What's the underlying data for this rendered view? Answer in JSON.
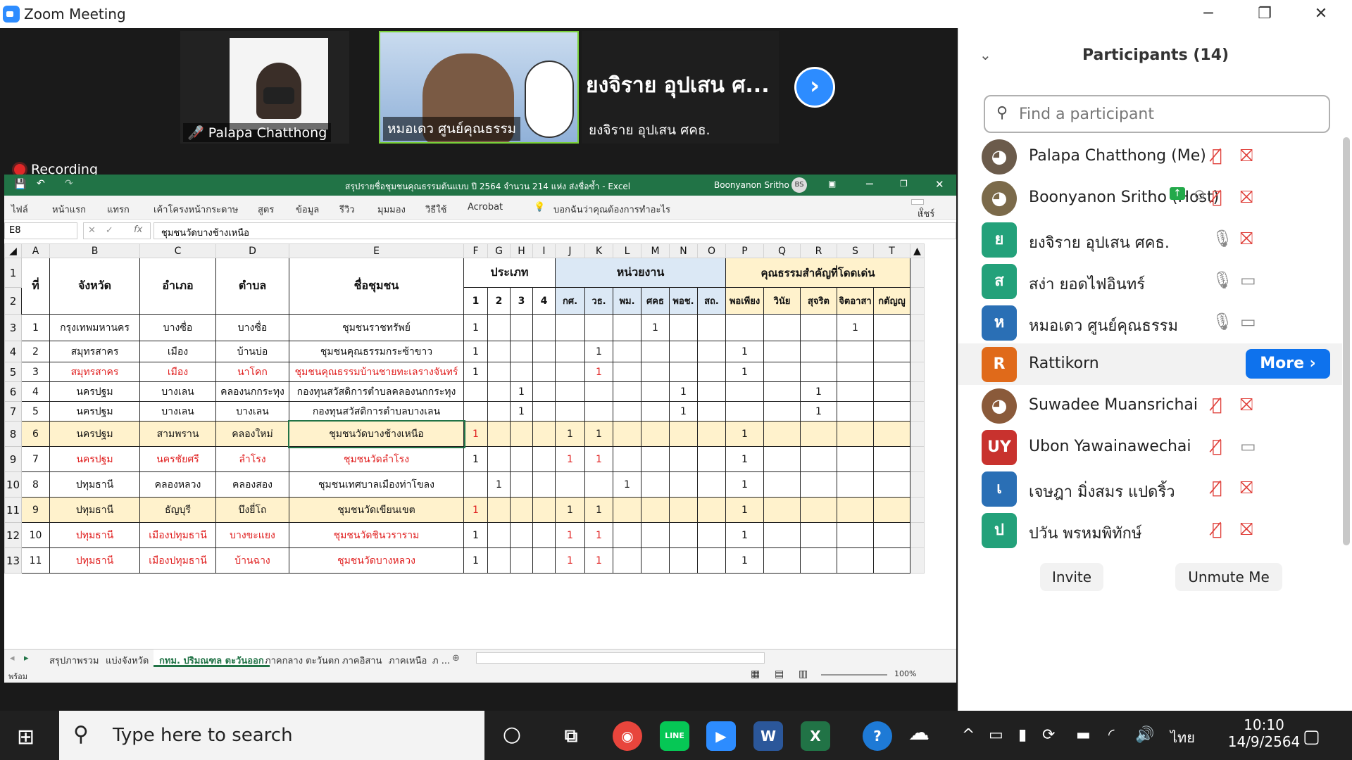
{
  "window": {
    "title": "Zoom Meeting"
  },
  "videos": [
    {
      "name": "Palapa Chatthong"
    },
    {
      "name": "หมอเดว ศูนย์คุณธรรม"
    },
    {
      "name": "ยงจิราย อุปเสน ศคธ.",
      "big": "ยงจิราย อุปเสน ศ..."
    }
  ],
  "recording": "Recording",
  "excel": {
    "title": "สรุปรายชื่อชุมชนคุณธรรมต้นแบบ ปี 2564 จำนวน 214 แห่ง ส่งชื่อซ้ำ - Excel",
    "user": "Boonyanon Sritho",
    "user_initials": "BS",
    "ribbon": [
      "ไฟล์",
      "หน้าแรก",
      "แทรก",
      "เค้าโครงหน้ากระดาษ",
      "สูตร",
      "ข้อมูล",
      "รีวิว",
      "มุมมอง",
      "วิธีใช้",
      "Acrobat",
      "บอกฉันว่าคุณต้องการทำอะไร"
    ],
    "share": "แชร์",
    "namebox": "E8",
    "formula": "ชุมชนวัดบางช้างเหนือ",
    "columns": [
      "A",
      "B",
      "C",
      "D",
      "E",
      "F",
      "G",
      "H",
      "I",
      "J",
      "K",
      "L",
      "M",
      "N",
      "O",
      "P",
      "Q",
      "R",
      "S",
      "T"
    ],
    "header1": {
      "num": "ที่",
      "province": "จังหวัด",
      "district": "อำเภอ",
      "subdistrict": "ตำบล",
      "community": "ชื่อชุมชน",
      "type": "ประเภท",
      "agency": "หน่วยงาน",
      "virtue": "คุณธรรมสำคัญที่โดดเด่น"
    },
    "header2": [
      "1",
      "2",
      "3",
      "4",
      "กศ.",
      "วธ.",
      "พม.",
      "ศคธ",
      "พอช.",
      "สถ.",
      "พอเพียง",
      "วินัย",
      "สุจริต",
      "จิตอาสา",
      "กตัญญู"
    ],
    "rows": [
      {
        "r": "3",
        "n": "1",
        "b": "กรุงเทพมหานคร",
        "c": "บางซื่อ",
        "d": "บางซื่อ",
        "e": "ชุมชนราชทรัพย์",
        "f": "1",
        "g": "",
        "h": "",
        "i": "",
        "j": "",
        "k": "",
        "l": "",
        "m": "1",
        "nn": "",
        "o": "",
        "p": "",
        "q": "",
        "rr": "",
        "s": "1",
        "t": "",
        "style": ""
      },
      {
        "r": "4",
        "n": "2",
        "b": "สมุทรสาคร",
        "c": "เมือง",
        "d": "บ้านบ่อ",
        "e": "ชุมชนคุณธรรมกระซ้าขาว",
        "f": "1",
        "g": "",
        "h": "",
        "i": "",
        "j": "",
        "k": "1",
        "l": "",
        "m": "",
        "nn": "",
        "o": "",
        "p": "1",
        "q": "",
        "rr": "",
        "s": "",
        "t": "",
        "style": ""
      },
      {
        "r": "5",
        "n": "3",
        "b": "สมุทรสาคร",
        "c": "เมือง",
        "d": "นาโคก",
        "e": "ชุมชนคุณธรรมบ้านชายทะเลรางจันทร์",
        "f": "1",
        "g": "",
        "h": "",
        "i": "",
        "j": "",
        "k": "1",
        "l": "",
        "m": "",
        "nn": "",
        "o": "",
        "p": "1",
        "q": "",
        "rr": "",
        "s": "",
        "t": "",
        "style": "red"
      },
      {
        "r": "6",
        "n": "4",
        "b": "นครปฐม",
        "c": "บางเลน",
        "d": "คลองนกกระทุง",
        "e": "กองทุนสวัสดิการตำบลคลองนกกระทุง",
        "f": "",
        "g": "",
        "h": "1",
        "i": "",
        "j": "",
        "k": "",
        "l": "",
        "m": "",
        "nn": "1",
        "o": "",
        "p": "",
        "q": "",
        "rr": "1",
        "s": "",
        "t": "",
        "style": ""
      },
      {
        "r": "7",
        "n": "5",
        "b": "นครปฐม",
        "c": "บางเลน",
        "d": "บางเลน",
        "e": "กองทุนสวัสดิการตำบลบางเลน",
        "f": "",
        "g": "",
        "h": "1",
        "i": "",
        "j": "",
        "k": "",
        "l": "",
        "m": "",
        "nn": "1",
        "o": "",
        "p": "",
        "q": "",
        "rr": "1",
        "s": "",
        "t": "",
        "style": ""
      },
      {
        "r": "8",
        "n": "6",
        "b": "นครปฐม",
        "c": "สามพราน",
        "d": "คลองใหม่",
        "e": "ชุมชนวัดบางช้างเหนือ",
        "f": "1",
        "g": "",
        "h": "",
        "i": "",
        "j": "1",
        "k": "1",
        "l": "",
        "m": "",
        "nn": "",
        "o": "",
        "p": "1",
        "q": "",
        "rr": "",
        "s": "",
        "t": "",
        "style": "hl"
      },
      {
        "r": "9",
        "n": "7",
        "b": "นครปฐม",
        "c": "นครชัยศรี",
        "d": "ลำโรง",
        "e": "ชุมชนวัดลำโรง",
        "f": "1",
        "g": "",
        "h": "",
        "i": "",
        "j": "1",
        "k": "1",
        "l": "",
        "m": "",
        "nn": "",
        "o": "",
        "p": "1",
        "q": "",
        "rr": "",
        "s": "",
        "t": "",
        "style": "red"
      },
      {
        "r": "10",
        "n": "8",
        "b": "ปทุมธานี",
        "c": "คลองหลวง",
        "d": "คลองสอง",
        "e": "ชุมชนเทศบาลเมืองท่าโขลง",
        "f": "",
        "g": "1",
        "h": "",
        "i": "",
        "j": "",
        "k": "",
        "l": "1",
        "m": "",
        "nn": "",
        "o": "",
        "p": "1",
        "q": "",
        "rr": "",
        "s": "",
        "t": "",
        "style": ""
      },
      {
        "r": "11",
        "n": "9",
        "b": "ปทุมธานี",
        "c": "ธัญบุรี",
        "d": "บึงยี่โถ",
        "e": "ชุมชนวัดเขียนเขต",
        "f": "1",
        "g": "",
        "h": "",
        "i": "",
        "j": "1",
        "k": "1",
        "l": "",
        "m": "",
        "nn": "",
        "o": "",
        "p": "1",
        "q": "",
        "rr": "",
        "s": "",
        "t": "",
        "style": "hl"
      },
      {
        "r": "12",
        "n": "10",
        "b": "ปทุมธานี",
        "c": "เมืองปทุมธานี",
        "d": "บางขะแยง",
        "e": "ชุมชนวัดชินวราราม",
        "f": "1",
        "g": "",
        "h": "",
        "i": "",
        "j": "1",
        "k": "1",
        "l": "",
        "m": "",
        "nn": "",
        "o": "",
        "p": "1",
        "q": "",
        "rr": "",
        "s": "",
        "t": "",
        "style": "red"
      },
      {
        "r": "13",
        "n": "11",
        "b": "ปทุมธานี",
        "c": "เมืองปทุมธานี",
        "d": "บ้านฉาง",
        "e": "ชุมชนวัดบางหลวง",
        "f": "1",
        "g": "",
        "h": "",
        "i": "",
        "j": "1",
        "k": "1",
        "l": "",
        "m": "",
        "nn": "",
        "o": "",
        "p": "1",
        "q": "",
        "rr": "",
        "s": "",
        "t": "",
        "style": "red"
      }
    ],
    "sheets": [
      "สรุปภาพรวม",
      "แบ่งจังหวัด",
      "กทม. ปริมณฑล ตะวันออก",
      "ภาคกลาง ตะวันตก",
      "ภาคอิสาน",
      "ภาคเหนือ",
      "ภ ..."
    ],
    "status": "พร้อม",
    "zoom": "100%"
  },
  "participants": {
    "title": "Participants (14)",
    "search_placeholder": "Find a participant",
    "list": [
      {
        "name": "Palapa Chatthong (Me)",
        "initials": "",
        "color": "#6b5b4b",
        "mic": "off",
        "cam": "off"
      },
      {
        "name": "Boonyanon Sritho (Host)",
        "initials": "",
        "color": "#7b6a4a",
        "mic": "off",
        "cam": "off"
      },
      {
        "name": "ยงจิราย อุปเสน ศคธ.",
        "initials": "ย",
        "color": "#23a17a",
        "mic": "on",
        "cam": "off"
      },
      {
        "name": "สง่า ยอดไฟอินทร์",
        "initials": "ส",
        "color": "#23a17a",
        "mic": "on",
        "cam": "on"
      },
      {
        "name": "หมอเดว ศูนย์คุณธรรม",
        "initials": "ห",
        "color": "#2a6fb5",
        "mic": "on",
        "cam": "on"
      },
      {
        "name": "Rattikorn",
        "initials": "R",
        "color": "#e06a1a",
        "mic": "",
        "cam": ""
      },
      {
        "name": "Suwadee Muansrichai",
        "initials": "",
        "color": "#8a5a3a",
        "mic": "off",
        "cam": "off"
      },
      {
        "name": "Ubon Yawainawechai",
        "initials": "UY",
        "color": "#c8322e",
        "mic": "off",
        "cam": "on"
      },
      {
        "name": "เจษฎา มิ่งสมร แปดริ้ว",
        "initials": "เ",
        "color": "#2a6fb5",
        "mic": "off",
        "cam": "off"
      },
      {
        "name": "ปวัน พรหมพิทักษ์",
        "initials": "ป",
        "color": "#23a17a",
        "mic": "off",
        "cam": "off"
      }
    ],
    "more": "More",
    "invite": "Invite",
    "unmute": "Unmute Me"
  },
  "taskbar": {
    "search": "Type here to search",
    "lang": "ไทย",
    "time": "10:10",
    "date": "14/9/2564"
  }
}
